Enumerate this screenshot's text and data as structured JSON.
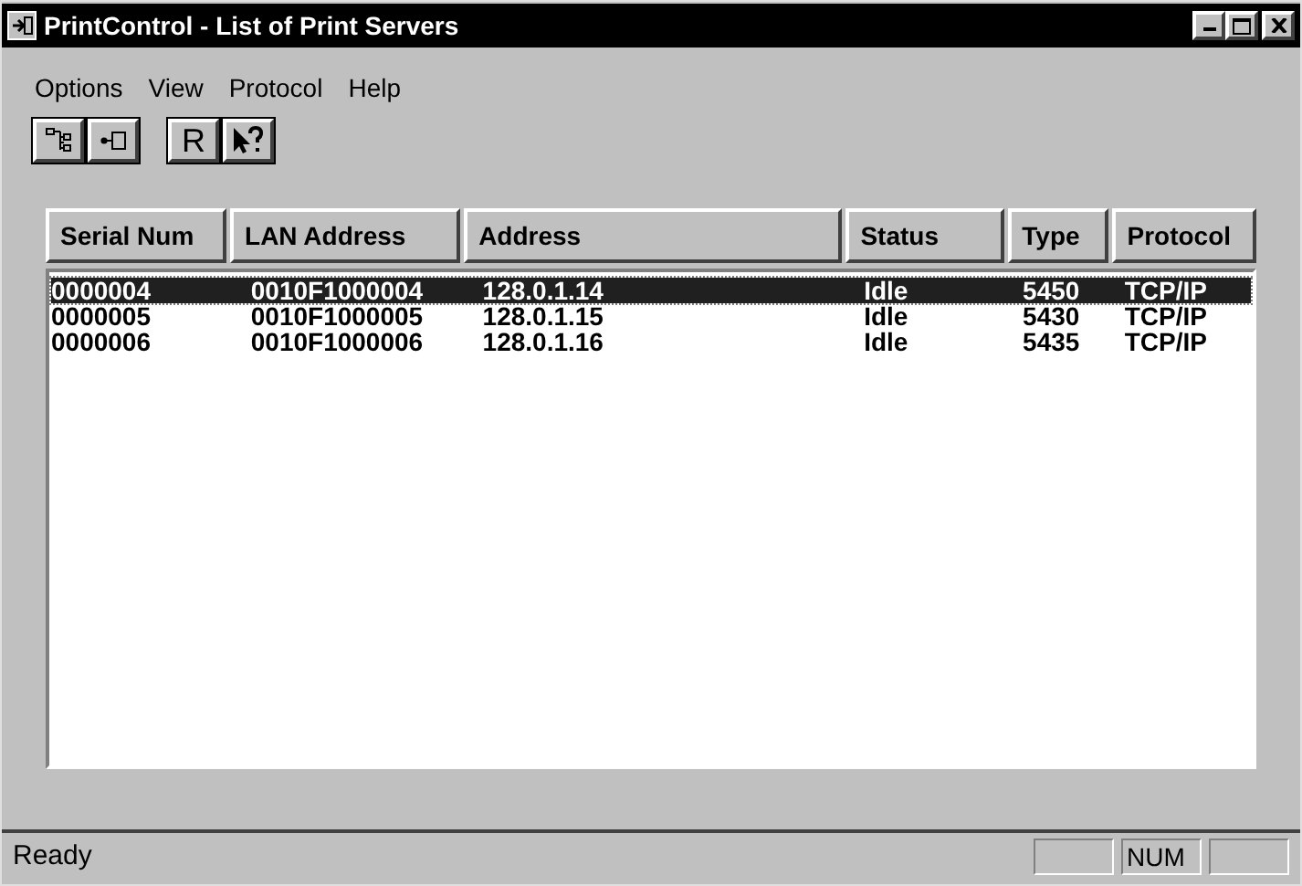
{
  "window": {
    "title": "PrintControl - List of Print Servers"
  },
  "menu": [
    "Options",
    "View",
    "Protocol",
    "Help"
  ],
  "toolbar": [
    {
      "kind": "tree"
    },
    {
      "kind": "connect"
    },
    {
      "kind": "text",
      "label": "R"
    },
    {
      "kind": "help"
    }
  ],
  "table": {
    "columns": [
      "Serial Num",
      "LAN Address",
      "Address",
      "Status",
      "Type",
      "Protocol"
    ],
    "rows": [
      {
        "selected": true,
        "cells": [
          "0000004",
          "0010F1000004",
          "128.0.1.14",
          "Idle",
          "5450",
          "TCP/IP"
        ]
      },
      {
        "selected": false,
        "cells": [
          "0000005",
          "0010F1000005",
          "128.0.1.15",
          "Idle",
          "5430",
          "TCP/IP"
        ]
      },
      {
        "selected": false,
        "cells": [
          "0000006",
          "0010F1000006",
          "128.0.1.16",
          "Idle",
          "5435",
          "TCP/IP"
        ]
      }
    ]
  },
  "status_bar": {
    "text": "Ready",
    "num_indicator": "NUM"
  }
}
